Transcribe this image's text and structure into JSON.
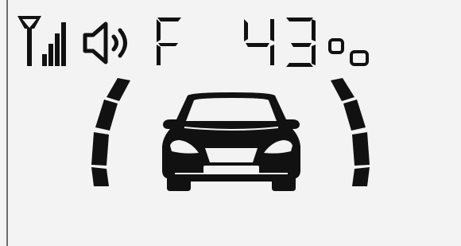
{
  "colors": {
    "background": "#f3f3f3",
    "segment_on": "#111111",
    "bezel": "#6b6b6b"
  },
  "status_bar": {
    "signal_icon": "signal-strength-icon",
    "signal_bars": 4,
    "speaker_icon": "speaker-volume-icon",
    "mode_letter": "F",
    "value_digits": "43",
    "unit_symbol": "°c"
  },
  "parking_display": {
    "car_icon": "car-front-icon",
    "left_sensor_level": 1,
    "right_sensor_level": 1
  }
}
